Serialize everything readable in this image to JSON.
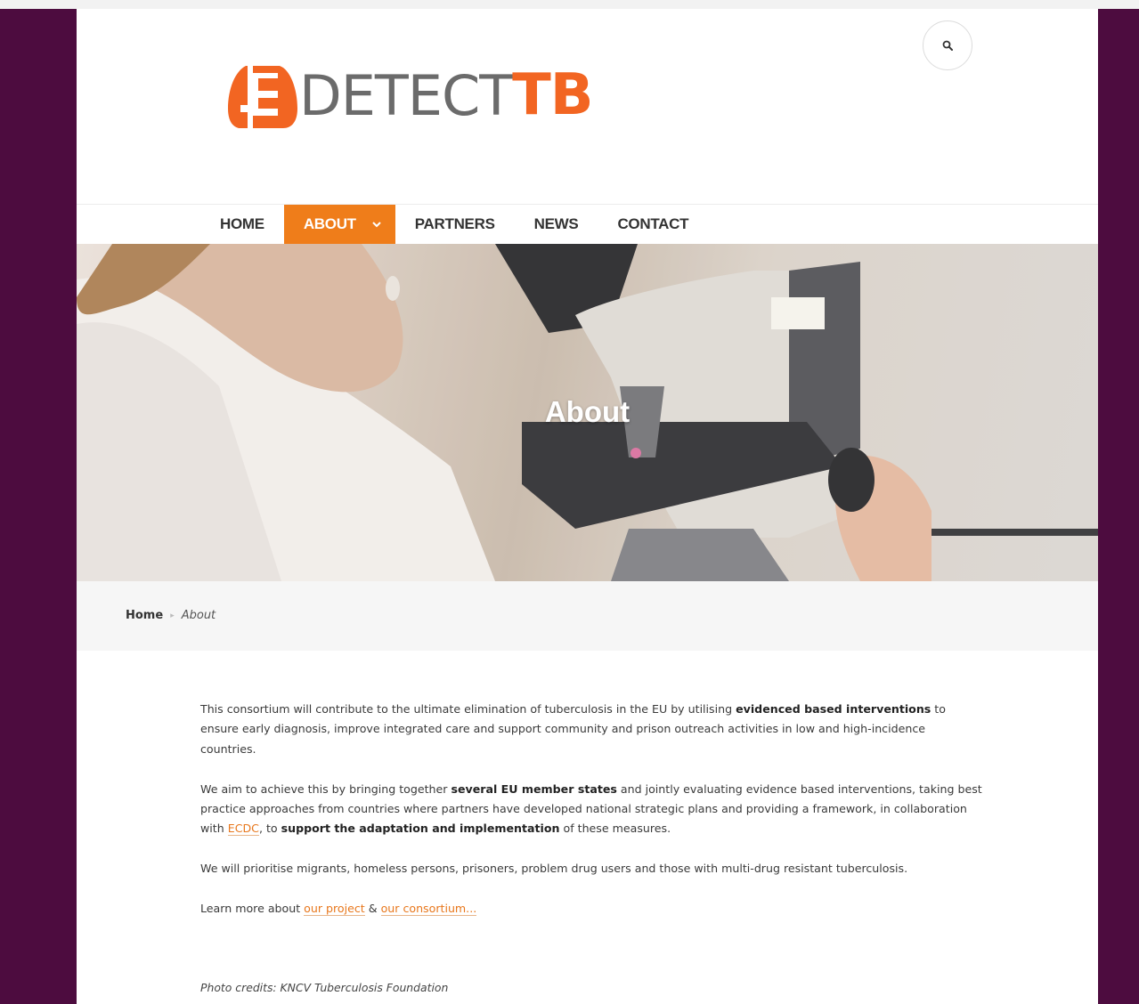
{
  "brand": {
    "word1": "DETECT",
    "word2": "TB",
    "colors": {
      "orange": "#f26522",
      "grey": "#6b6b6b",
      "frame": "#4d0c3f",
      "nav_active": "#ef7d1a"
    }
  },
  "header": {
    "search_icon": "search-icon"
  },
  "nav": {
    "items": [
      {
        "label": "HOME"
      },
      {
        "label": "ABOUT",
        "active": true,
        "icon": "chevron-down-icon"
      },
      {
        "label": "PARTNERS"
      },
      {
        "label": "NEWS"
      },
      {
        "label": "CONTACT"
      }
    ]
  },
  "hero": {
    "title": "About"
  },
  "breadcrumb": {
    "home": "Home",
    "current": "About"
  },
  "content": {
    "p1": {
      "a": "This consortium will contribute to the ultimate elimination of tuberculosis in the EU by utilising ",
      "b": "evidenced based interventions",
      "c": " to ensure early diagnosis, improve integrated care and support community and prison outreach activities in low and high-incidence countries."
    },
    "p2": {
      "a": "We aim to achieve this by bringing together ",
      "b": "several EU member states",
      "c": " and jointly evaluating evidence based interventions, taking best practice approaches from countries where partners have developed national strategic plans and providing a framework, in collaboration with ",
      "link": "ECDC",
      "d": ", to ",
      "e": "support the adaptation and implementation",
      "f": " of these measures."
    },
    "p3": "We will prioritise migrants, homeless persons, prisoners, problem drug users and those with multi-drug resistant tuberculosis.",
    "p4": {
      "a": "Learn more about ",
      "link1": "our project",
      "b": " & ",
      "link2": "our consortium..."
    },
    "credit": "Photo credits: KNCV Tuberculosis Foundation"
  }
}
